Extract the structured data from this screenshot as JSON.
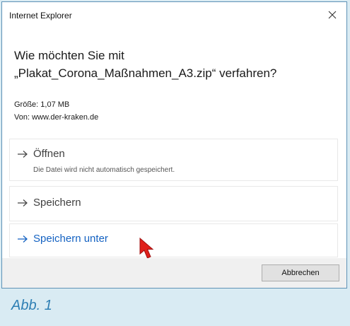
{
  "colors": {
    "page_background": "#d9ebf3",
    "dialog_border": "#5e92b6",
    "link_blue": "#1462c2",
    "caption_blue": "#2e7fb4",
    "cursor_red": "#e0201b"
  },
  "dialog": {
    "title": "Internet Explorer",
    "close_icon": "close-icon",
    "question_line1": "Wie möchten Sie mit",
    "question_line2": "„Plakat_Corona_Maßnahmen_A3.zip“ verfahren?",
    "size_line": "Größe: 1,07 MB",
    "from_line": "Von: www.der-kraken.de",
    "options": [
      {
        "label": "Öffnen",
        "sublabel": "Die Datei wird nicht automatisch gespeichert.",
        "icon": "arrow-right-icon"
      },
      {
        "label": "Speichern",
        "icon": "arrow-right-icon"
      },
      {
        "label": "Speichern unter",
        "icon": "arrow-right-icon",
        "highlighted": true
      }
    ],
    "cursor_icon": "mouse-pointer-icon",
    "cancel_label": "Abbrechen"
  },
  "caption": "Abb. 1"
}
